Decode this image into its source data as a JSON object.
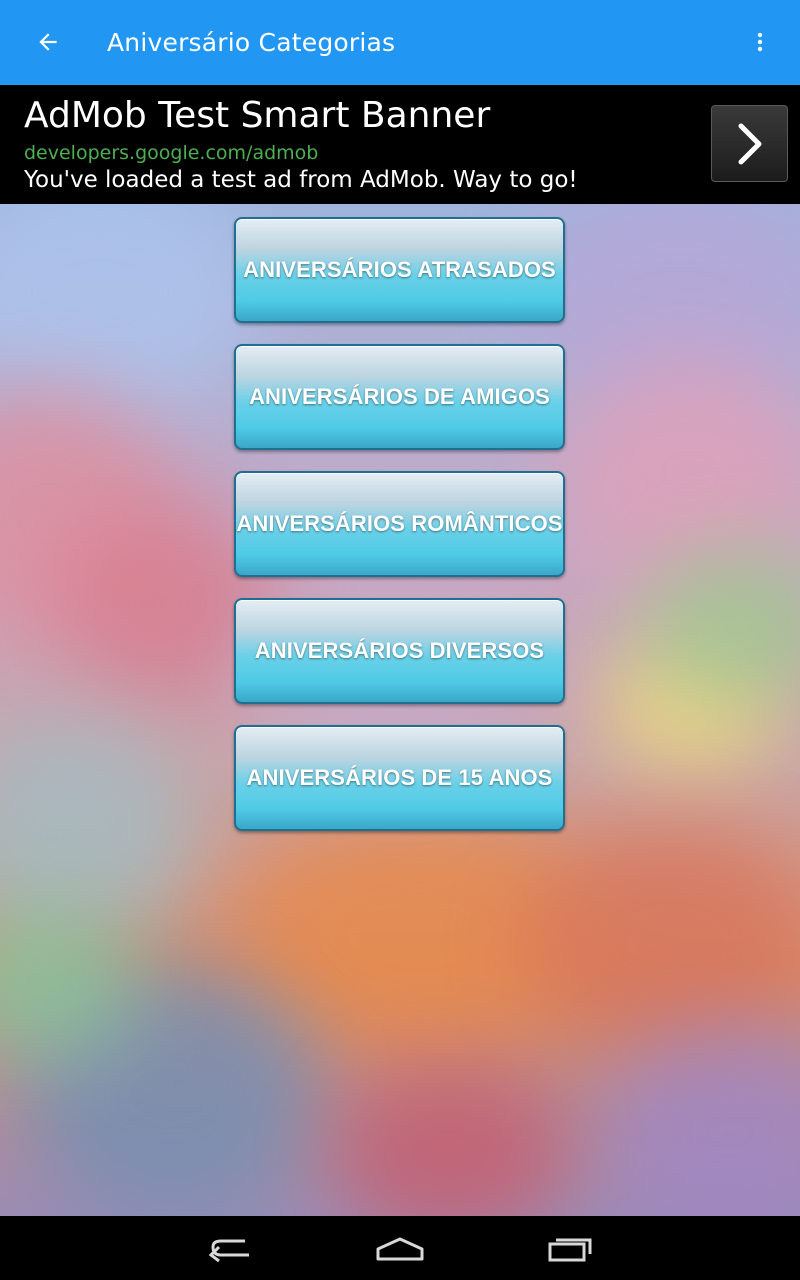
{
  "app_bar": {
    "title": "Aniversário Categorias",
    "back_icon": "arrow-back-icon",
    "menu_icon": "more-vert-icon",
    "color": "#2196F3"
  },
  "ad_banner": {
    "title": "AdMob Test Smart Banner",
    "url": "developers.google.com/admob",
    "description": "You've loaded a test ad from AdMob. Way to go!",
    "arrow_icon": "chevron-right-icon"
  },
  "categories": [
    {
      "label": "ANIVERSÁRIOS ATRASADOS"
    },
    {
      "label": "ANIVERSÁRIOS DE AMIGOS"
    },
    {
      "label": "ANIVERSÁRIOS ROMÂNTICOS"
    },
    {
      "label": "ANIVERSÁRIOS DIVERSOS"
    },
    {
      "label": "ANIVERSÁRIOS DE 15 ANOS"
    }
  ],
  "nav_bar": {
    "back_icon": "nav-back-icon",
    "home_icon": "nav-home-icon",
    "recents_icon": "nav-recents-icon"
  }
}
